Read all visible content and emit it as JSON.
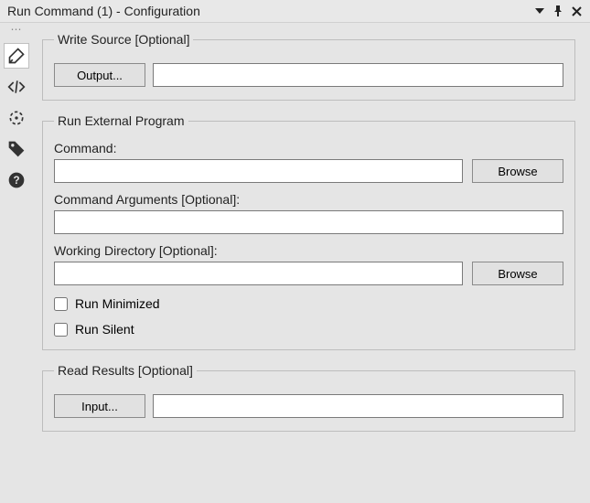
{
  "window": {
    "title": "Run Command (1) - Configuration"
  },
  "groups": {
    "write_source": {
      "legend": "Write Source [Optional]",
      "output_button": "Output...",
      "output_value": ""
    },
    "run_external": {
      "legend": "Run External Program",
      "command_label": "Command:",
      "command_value": "",
      "command_browse": "Browse",
      "args_label": "Command Arguments [Optional]:",
      "args_value": "",
      "wd_label": "Working Directory [Optional]:",
      "wd_value": "",
      "wd_browse": "Browse",
      "run_minimized_label": "Run Minimized",
      "run_minimized_checked": false,
      "run_silent_label": "Run Silent",
      "run_silent_checked": false
    },
    "read_results": {
      "legend": "Read Results [Optional]",
      "input_button": "Input...",
      "input_value": ""
    }
  }
}
